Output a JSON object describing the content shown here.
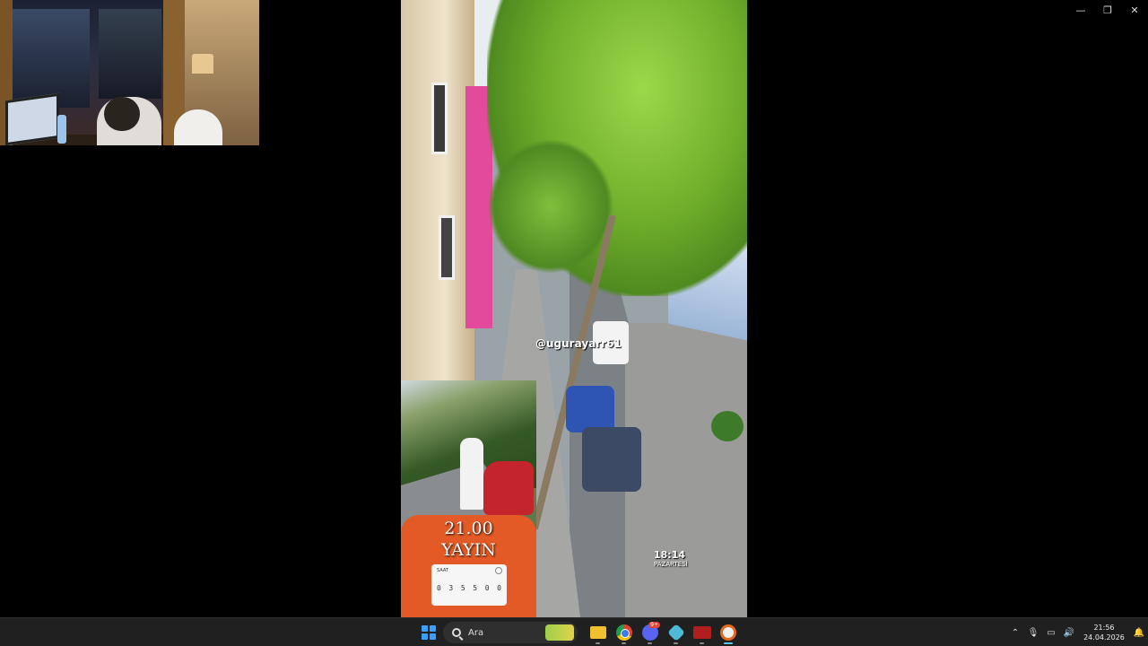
{
  "window_controls": {
    "minimize": "—",
    "restore": "❐",
    "close": "✕"
  },
  "video": {
    "watermark": "@ugurayarr61",
    "time": "18:14",
    "day": "PAZARTESİ"
  },
  "promo": {
    "time": "21.00",
    "label": "YAYIN",
    "card_header": "SAAT",
    "digits": [
      "0",
      "3",
      "5",
      "5",
      "0",
      "0"
    ]
  },
  "taskbar": {
    "search_placeholder": "Ara",
    "apps": [
      "file-explorer",
      "chrome",
      "discord",
      "extension",
      "voicemeeter",
      "media-player"
    ],
    "discord_badge": "9+",
    "clock_time": "21:56",
    "clock_date": "24.04.2026"
  },
  "colors": {
    "taskbar_bg": "#202020",
    "accent": "#3aa0ff"
  }
}
